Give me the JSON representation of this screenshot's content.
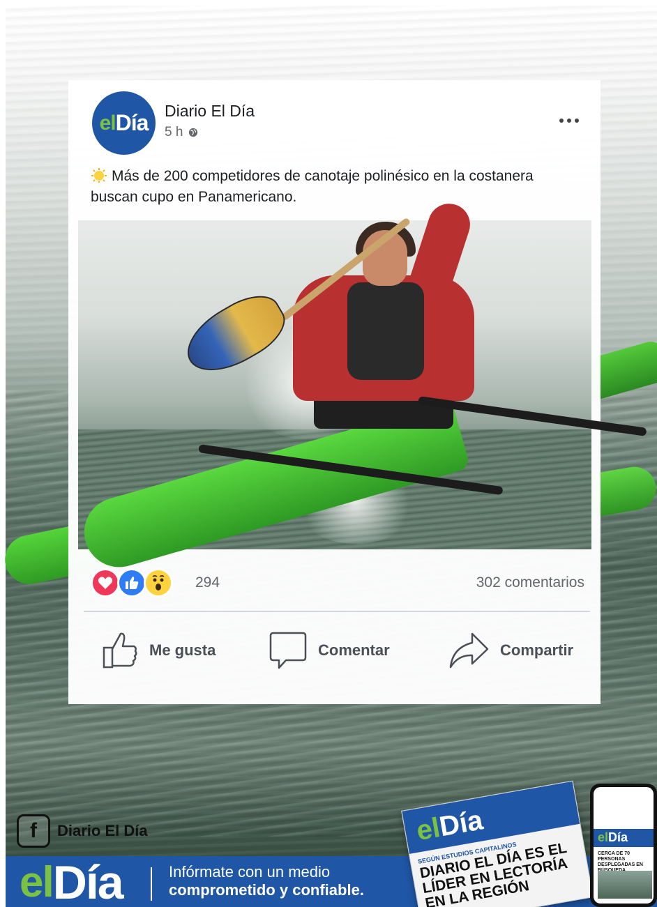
{
  "post": {
    "page_name": "Diario El Día",
    "avatar_logo": {
      "part1": "el",
      "part2": "Día"
    },
    "time": "5 h",
    "privacy_icon": "globe-icon",
    "more_icon": "more-options-icon",
    "text": "Más de 200 competidores de canotaje polinésico en la costanera buscan cupo en Panamericano.",
    "leading_emoji": "sun-emoji-icon"
  },
  "reactions": {
    "icons": [
      "love-reaction-icon",
      "like-reaction-icon",
      "wow-reaction-icon"
    ],
    "count": "294",
    "comments": "302 comentarios"
  },
  "actions": {
    "like": "Me gusta",
    "comment": "Comentar",
    "share": "Compartir"
  },
  "footer": {
    "facebook_handle": "Diario El Día",
    "brand": {
      "part1": "el",
      "part2": "Día"
    },
    "tagline_line1": "Infórmate con un medio",
    "tagline_line2": "comprometido y confiable.",
    "newspaper": {
      "logo_part1": "el",
      "logo_part2": "Día",
      "kicker": "SEGÚN ESTUDIOS CAPITALINOS",
      "headline": "DIARIO EL DÍA ES EL LÍDER EN LECTORÍA EN LA REGIÓN"
    },
    "phone": {
      "logo_part1": "el",
      "logo_part2": "Día",
      "headline": "CERCA DE 70 PERSONAS DESPLEGADAS EN BÚSQUEDA"
    }
  },
  "colors": {
    "brand_blue": "#1f56a5",
    "brand_green": "#7cc242",
    "love": "#f0375a",
    "like": "#2e7cf6",
    "wow": "#ffd23e"
  }
}
